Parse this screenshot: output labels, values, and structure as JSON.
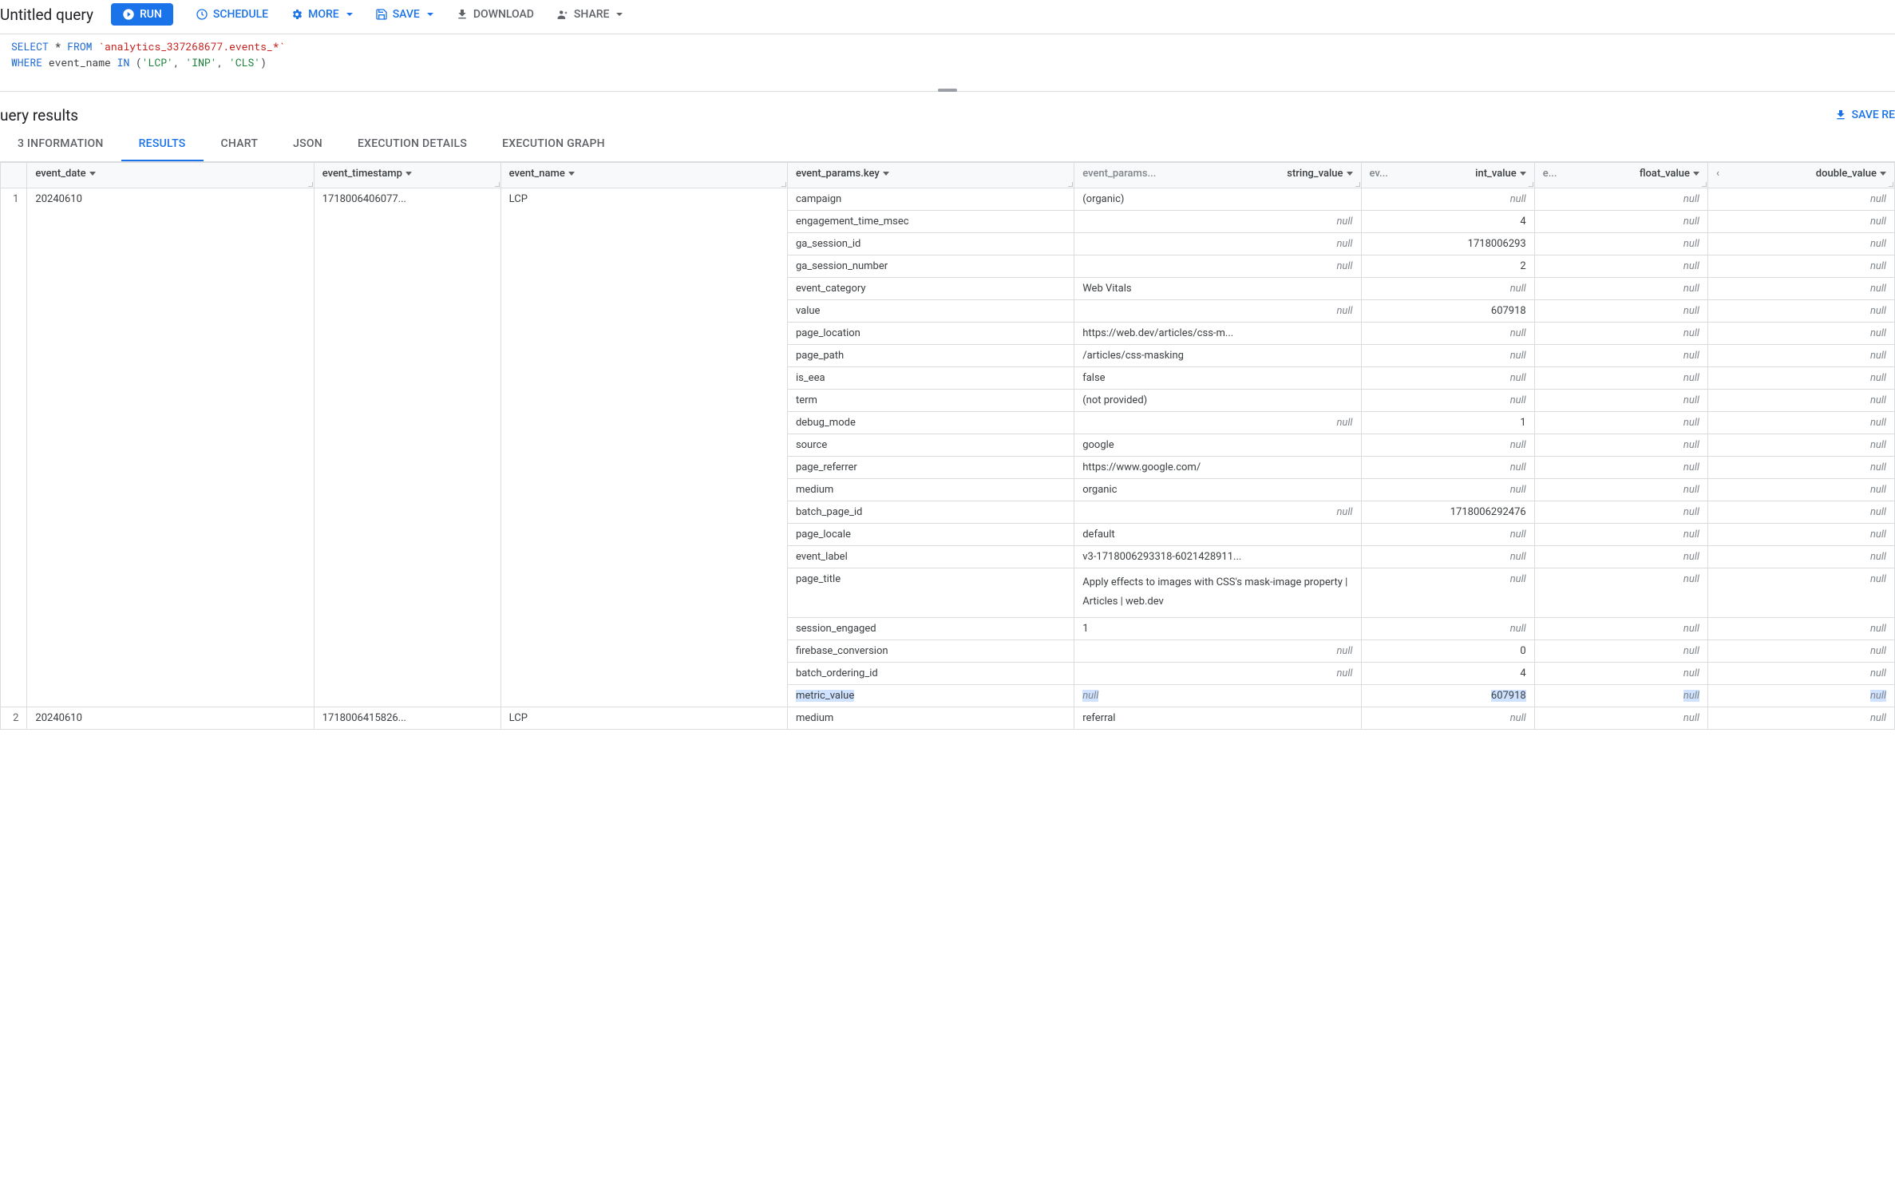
{
  "header": {
    "title": "Untitled query",
    "run": "RUN",
    "schedule": "SCHEDULE",
    "more": "MORE",
    "save": "SAVE",
    "download": "DOWNLOAD",
    "share": "SHARE"
  },
  "sql": {
    "select": "SELECT",
    "star_from": " * ",
    "from": "FROM",
    "table": " `analytics_337268677.events_*`",
    "where": "WHERE",
    "col": " event_name ",
    "in": "IN",
    "paren_open": " (",
    "v1": "'LCP'",
    "c1": ", ",
    "v2": "'INP'",
    "c2": ", ",
    "v3": "'CLS'",
    "paren_close": ")"
  },
  "results": {
    "title": "uery results",
    "save_results": "SAVE RE"
  },
  "tabs": [
    {
      "label": "3 INFORMATION",
      "active": false
    },
    {
      "label": "RESULTS",
      "active": true
    },
    {
      "label": "CHART",
      "active": false
    },
    {
      "label": "JSON",
      "active": false
    },
    {
      "label": "EXECUTION DETAILS",
      "active": false
    },
    {
      "label": "EXECUTION GRAPH",
      "active": false
    }
  ],
  "columns": {
    "row": "",
    "event_date": "event_date",
    "event_timestamp": "event_timestamp",
    "event_name": "event_name",
    "key": "event_params.key",
    "string_value": "string_value",
    "string_value_prefix": "event_params...",
    "int_value": "int_value",
    "int_prefix": "ev...",
    "float_value": "float_value",
    "float_prefix": "e...",
    "double_value": "double_value",
    "double_prefix": "‹"
  },
  "data_rows": [
    {
      "idx": "1",
      "event_date": "20240610",
      "event_timestamp": "1718006406077...",
      "event_name": "LCP",
      "params": [
        {
          "key": "campaign",
          "str": "(organic)",
          "int": null,
          "float": null,
          "double": null
        },
        {
          "key": "engagement_time_msec",
          "str": null,
          "int": "4",
          "float": null,
          "double": null
        },
        {
          "key": "ga_session_id",
          "str": null,
          "int": "1718006293",
          "float": null,
          "double": null
        },
        {
          "key": "ga_session_number",
          "str": null,
          "int": "2",
          "float": null,
          "double": null
        },
        {
          "key": "event_category",
          "str": "Web Vitals",
          "int": null,
          "float": null,
          "double": null
        },
        {
          "key": "value",
          "str": null,
          "int": "607918",
          "float": null,
          "double": null
        },
        {
          "key": "page_location",
          "str": "https://web.dev/articles/css-m...",
          "int": null,
          "float": null,
          "double": null
        },
        {
          "key": "page_path",
          "str": "/articles/css-masking",
          "int": null,
          "float": null,
          "double": null
        },
        {
          "key": "is_eea",
          "str": "false",
          "int": null,
          "float": null,
          "double": null
        },
        {
          "key": "term",
          "str": "(not provided)",
          "int": null,
          "float": null,
          "double": null
        },
        {
          "key": "debug_mode",
          "str": null,
          "int": "1",
          "float": null,
          "double": null
        },
        {
          "key": "source",
          "str": "google",
          "int": null,
          "float": null,
          "double": null
        },
        {
          "key": "page_referrer",
          "str": "https://www.google.com/",
          "int": null,
          "float": null,
          "double": null
        },
        {
          "key": "medium",
          "str": "organic",
          "int": null,
          "float": null,
          "double": null
        },
        {
          "key": "batch_page_id",
          "str": null,
          "int": "1718006292476",
          "float": null,
          "double": null
        },
        {
          "key": "page_locale",
          "str": "default",
          "int": null,
          "float": null,
          "double": null
        },
        {
          "key": "event_label",
          "str": "v3-1718006293318-6021428911...",
          "int": null,
          "float": null,
          "double": null
        },
        {
          "key": "page_title",
          "str": "Apply effects to images with CSS's mask-image property  |  Articles  |  web.dev",
          "int": null,
          "float": null,
          "double": null,
          "wrap": true
        },
        {
          "key": "session_engaged",
          "str": "1",
          "int": null,
          "float": null,
          "double": null
        },
        {
          "key": "firebase_conversion",
          "str": null,
          "int": "0",
          "float": null,
          "double": null
        },
        {
          "key": "batch_ordering_id",
          "str": null,
          "int": "4",
          "float": null,
          "double": null
        },
        {
          "key": "metric_value",
          "str": null,
          "int": "607918",
          "float": null,
          "double": null,
          "highlight": true
        }
      ]
    },
    {
      "idx": "2",
      "event_date": "20240610",
      "event_timestamp": "1718006415826...",
      "event_name": "LCP",
      "params": [
        {
          "key": "medium",
          "str": "referral",
          "int": null,
          "float": null,
          "double": null
        }
      ]
    }
  ],
  "null_text": "null"
}
